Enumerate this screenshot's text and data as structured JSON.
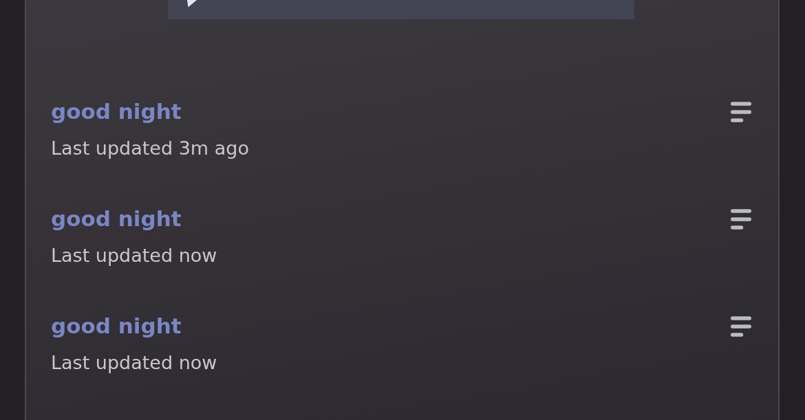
{
  "notes": [
    {
      "title": "good night",
      "updated": "Last updated 3m ago"
    },
    {
      "title": "good night",
      "updated": "Last updated now"
    },
    {
      "title": "good night",
      "updated": "Last updated now"
    }
  ]
}
